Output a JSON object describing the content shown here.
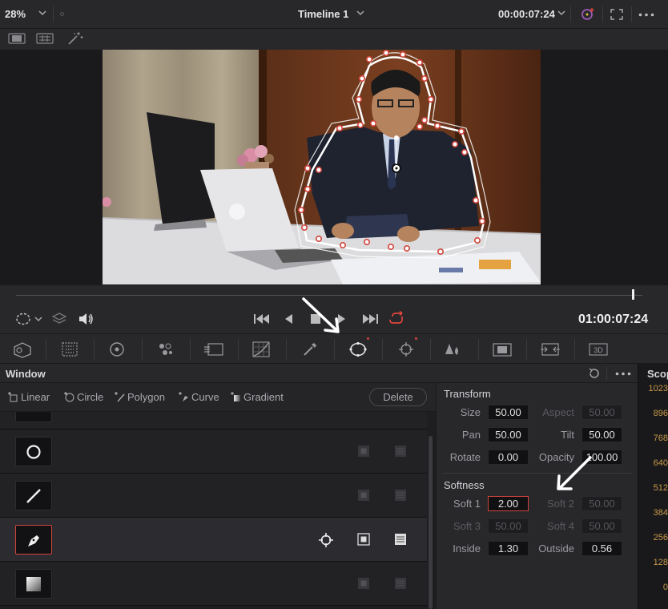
{
  "viewer": {
    "zoom": "28%",
    "timeline_title": "Timeline 1",
    "timecode_top": "00:00:07:24",
    "timecode": "01:00:07:24"
  },
  "window_panel": {
    "title": "Window",
    "shapes": {
      "linear": "Linear",
      "circle": "Circle",
      "polygon": "Polygon",
      "curve": "Curve",
      "gradient": "Gradient"
    },
    "delete_label": "Delete"
  },
  "window_list": [
    {
      "shape": "circle",
      "active": false
    },
    {
      "shape": "line",
      "active": false
    },
    {
      "shape": "pen",
      "active": true
    },
    {
      "shape": "gradient",
      "active": false
    }
  ],
  "transform": {
    "title": "Transform",
    "size_label": "Size",
    "size": "50.00",
    "aspect_label": "Aspect",
    "aspect": "50.00",
    "pan_label": "Pan",
    "pan": "50.00",
    "tilt_label": "Tilt",
    "tilt": "50.00",
    "rotate_label": "Rotate",
    "rotate": "0.00",
    "opacity_label": "Opacity",
    "opacity": "100.00"
  },
  "softness": {
    "title": "Softness",
    "soft1_label": "Soft 1",
    "soft1": "2.00",
    "soft2_label": "Soft 2",
    "soft2": "50.00",
    "soft3_label": "Soft 3",
    "soft3": "50.00",
    "soft4_label": "Soft 4",
    "soft4": "50.00",
    "inside_label": "Inside",
    "inside": "1.30",
    "outside_label": "Outside",
    "outside": "0.56"
  },
  "scopes": {
    "title": "Scop",
    "ticks": [
      "1023",
      "896",
      "768",
      "640",
      "512",
      "384",
      "256",
      "128",
      "0"
    ]
  },
  "colors": {
    "accent_red": "#d1453b",
    "panel": "#28282b",
    "scope_amber": "#c89a4a"
  }
}
